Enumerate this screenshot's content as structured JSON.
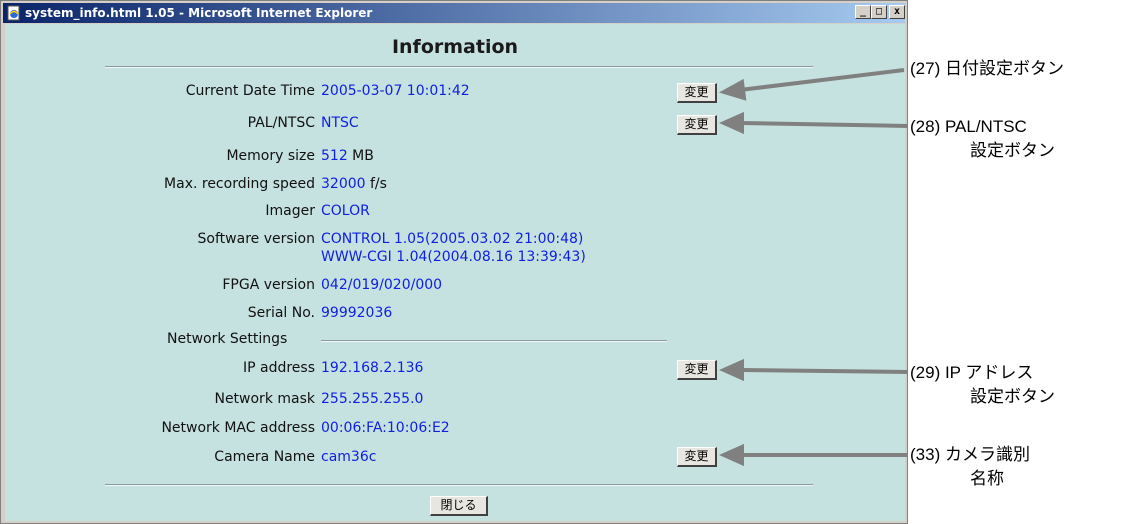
{
  "window": {
    "title": "system_info.html 1.05 - Microsoft Internet Explorer",
    "controls": [
      "_",
      "□",
      "x"
    ]
  },
  "page": {
    "heading": "Information",
    "rows": [
      {
        "label": "Current Date Time",
        "value": "2005-03-07 10:01:42",
        "unit": ""
      },
      {
        "label": "PAL/NTSC",
        "value": "NTSC",
        "unit": ""
      },
      {
        "label": "Memory size",
        "value": "512",
        "unit": " MB"
      },
      {
        "label": "Max. recording speed",
        "value": "32000",
        "unit": " f/s"
      },
      {
        "label": "Imager",
        "value": "COLOR",
        "unit": ""
      },
      {
        "label": "Software version",
        "value": "CONTROL 1.05(2005.03.02 21:00:48)",
        "value2": "WWW-CGI 1.04(2004.08.16 13:39:43)",
        "unit": ""
      },
      {
        "label": "FPGA version",
        "value": "042/019/020/000",
        "unit": ""
      },
      {
        "label": "Serial No.",
        "value": "99992036",
        "unit": ""
      }
    ],
    "network_title": "Network Settings",
    "network_rows": [
      {
        "label": "IP address",
        "value": "192.168.2.136"
      },
      {
        "label": "Network mask",
        "value": "255.255.255.0"
      },
      {
        "label": "Network MAC address",
        "value": "00:06:FA:10:06:E2"
      },
      {
        "label": "Camera Name",
        "value": "cam36c"
      }
    ],
    "change_label": "変更",
    "close_label": "閉じる"
  },
  "annotations": {
    "a27": "(27) 日付設定ボタン",
    "a28_line1": "(28) PAL/NTSC",
    "a28_line2": "設定ボタン",
    "a29_line1": "(29) IP アドレス",
    "a29_line2": "設定ボタン",
    "a33_line1": "(33) カメラ識別",
    "a33_line2": "名称"
  },
  "colors": {
    "content_bg": "#c6e2e0",
    "value_text": "#1020e0",
    "arrow": "#808080"
  }
}
